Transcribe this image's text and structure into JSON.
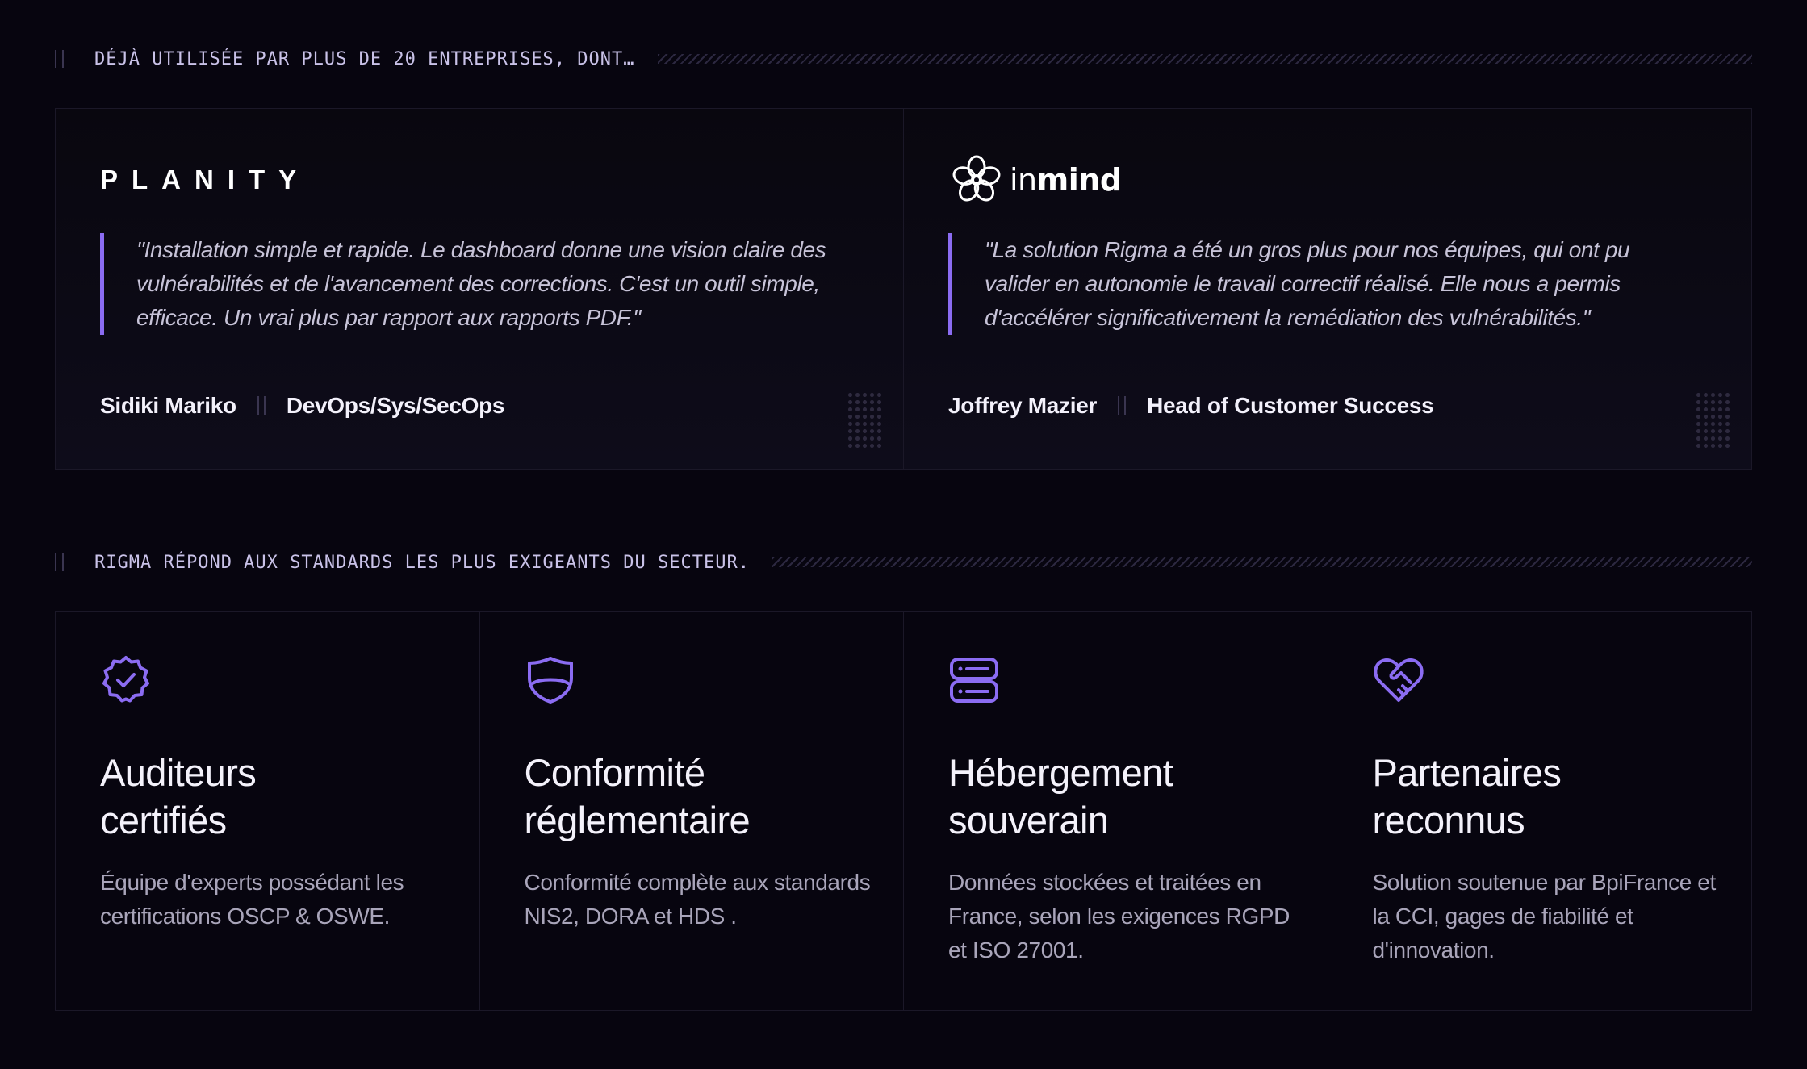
{
  "clients_section": {
    "label": "DÉJÀ UTILISÉE PAR PLUS DE 20 ENTREPRISES, DONT…"
  },
  "testimonials": [
    {
      "logo_text": "PLANITY",
      "quote": "\"Installation simple et rapide. Le dashboard donne une vision claire des vulnérabilités et de l'avancement des corrections. C'est un outil simple, efficace. Un vrai plus par rapport aux rapports PDF.\"",
      "author_name": "Sidiki Mariko",
      "author_role": "DevOps/Sys/SecOps"
    },
    {
      "logo_text_in": "in",
      "logo_text_mind": "mind",
      "logo_icon": "flower-icon",
      "quote": "\"La solution Rigma a été un gros plus pour nos équipes, qui ont pu valider en autonomie le travail correctif réalisé. Elle nous a permis d'accélérer significativement la remédiation des vulnérabilités.\"",
      "author_name": "Joffrey Mazier",
      "author_role": "Head of Customer Success"
    }
  ],
  "standards_section": {
    "label": "RIGMA RÉPOND AUX STANDARDS LES PLUS EXIGEANTS DU SECTEUR."
  },
  "features": [
    {
      "icon": "badge-check-icon",
      "title_line1": "Auditeurs",
      "title_line2": "certifiés",
      "description": "Équipe d'experts possédant les certifications OSCP & OSWE."
    },
    {
      "icon": "shield-icon",
      "title_line1": "Conformité",
      "title_line2": "réglementaire",
      "description": "Conformité complète aux standards NIS2, DORA et HDS ."
    },
    {
      "icon": "server-icon",
      "title_line1": "Hébergement",
      "title_line2": "souverain",
      "description": "Données stockées et traitées en France, selon les exigences RGPD et ISO 27001."
    },
    {
      "icon": "handshake-heart-icon",
      "title_line1": "Partenaires",
      "title_line2": "reconnus",
      "description": "Solution soutenue par BpiFrance et la CCI, gages de fiabilité et d'innovation."
    }
  ],
  "colors": {
    "background": "#07050f",
    "accent": "#8b6cf2",
    "text_primary": "#f4f2fb",
    "text_muted": "#a9a5ba",
    "label_text": "#c9c2e8"
  }
}
